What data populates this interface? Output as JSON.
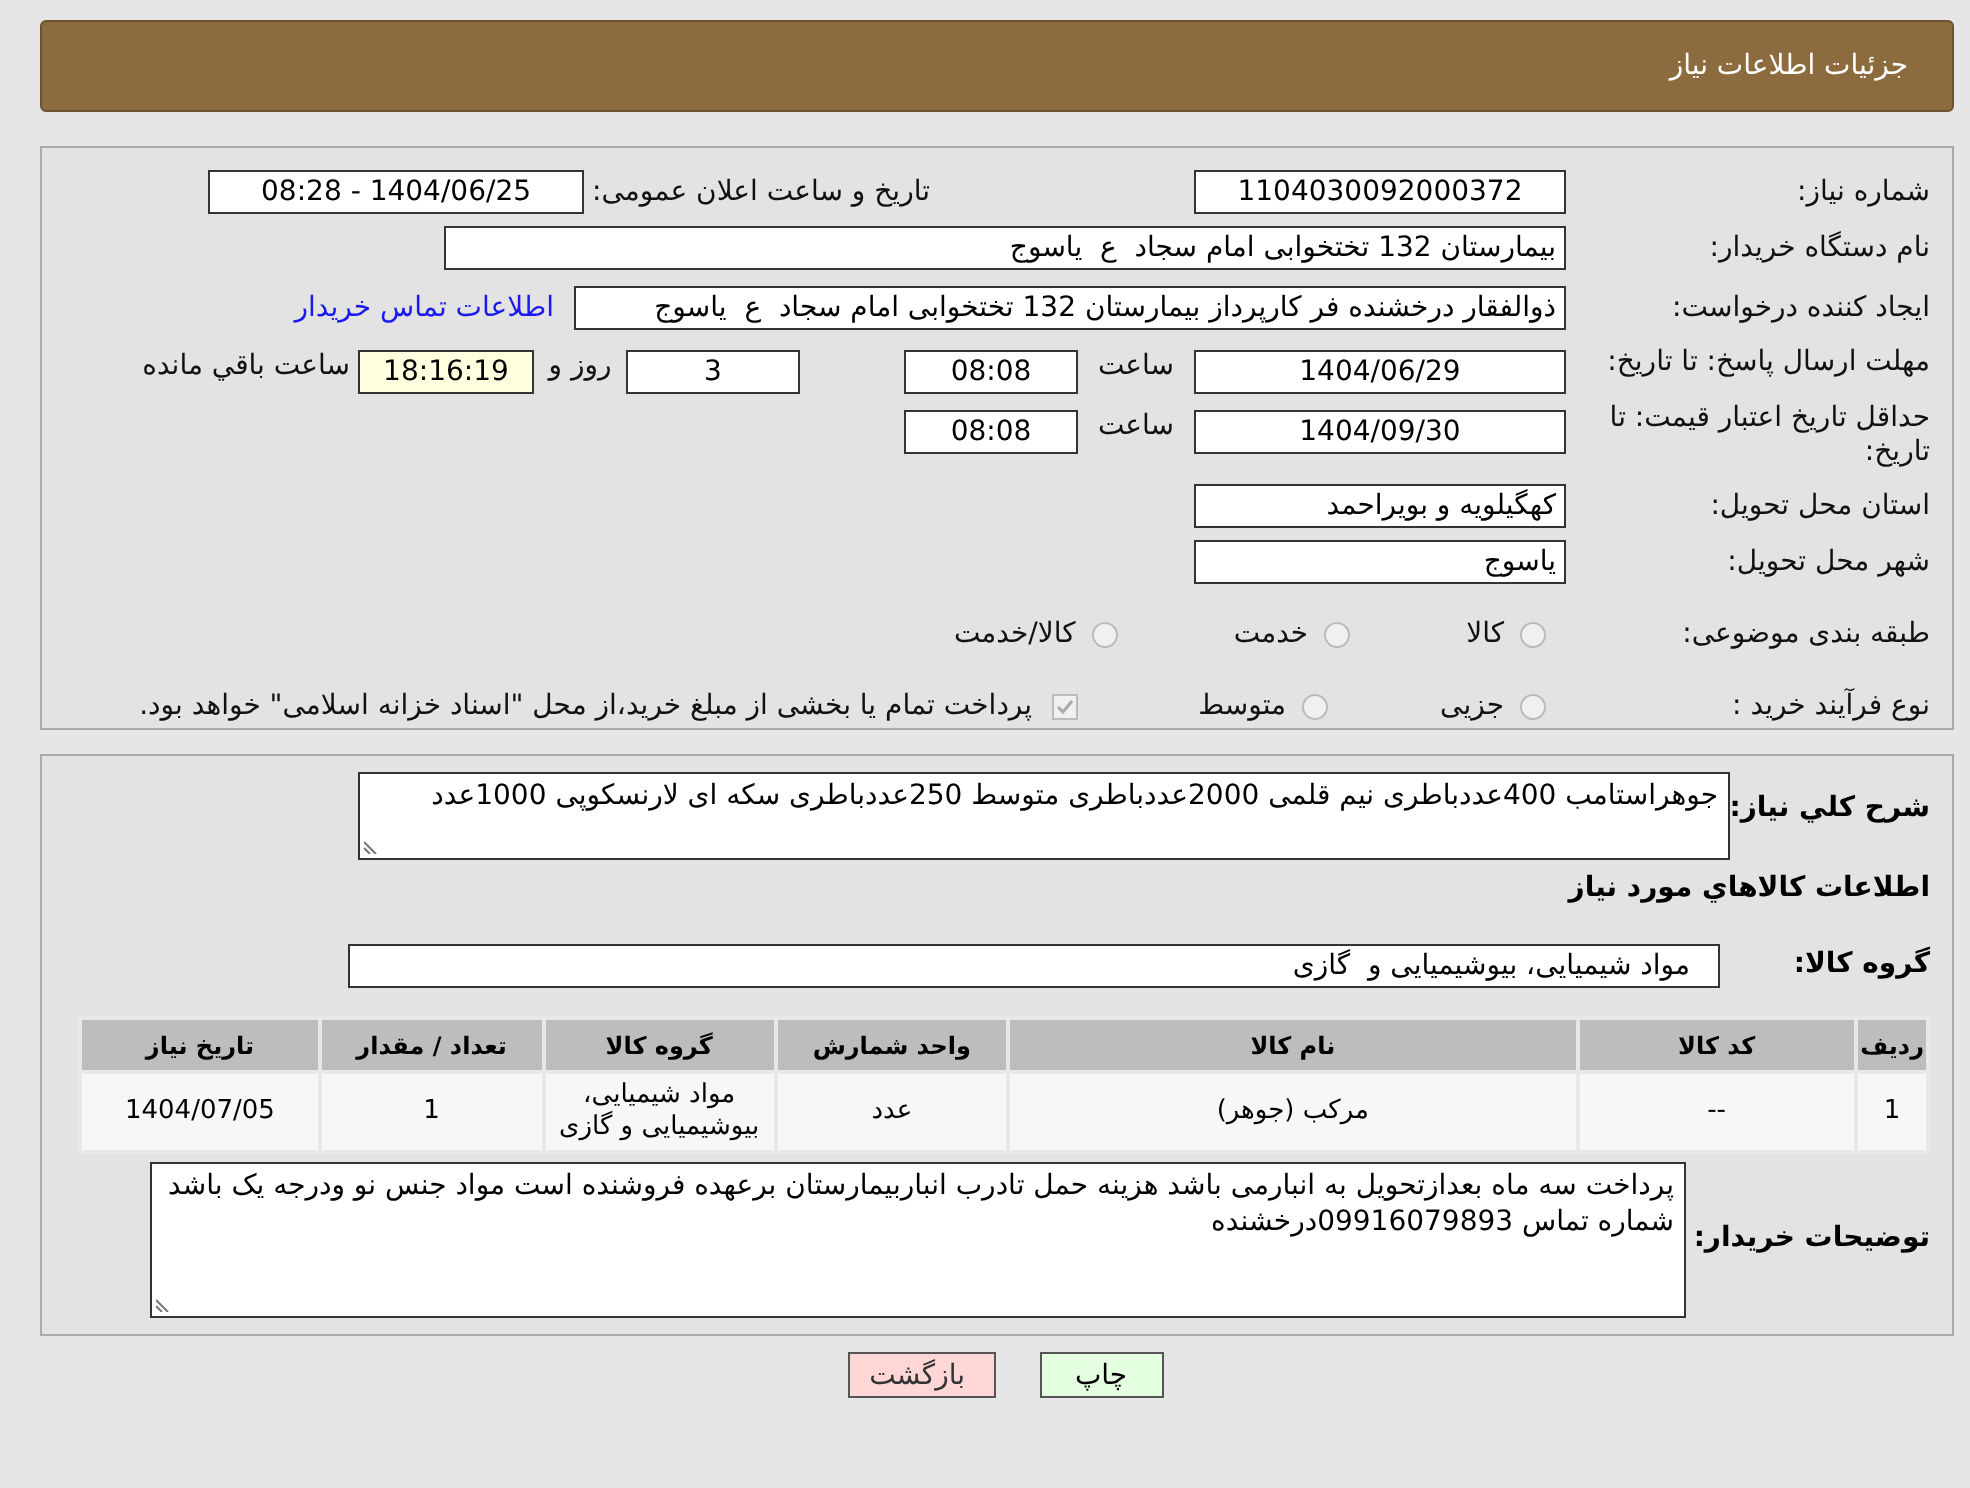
{
  "header": {
    "title": "جزئیات اطلاعات نیاز"
  },
  "info": {
    "need_number": {
      "label": "شماره نیاز:",
      "value": "1104030092000372"
    },
    "announce": {
      "label": "تاریخ و ساعت اعلان عمومی:",
      "value": "1404/06/25 - 08:28"
    },
    "buyer_org": {
      "label": "نام دستگاه خریدار:",
      "value": "بیمارستان 132 تختخوابی امام سجاد  ع  یاسوج"
    },
    "creator": {
      "label": "ایجاد کننده درخواست:",
      "value": "ذوالفقار درخشنده فر کارپرداز بیمارستان 132 تختخوابی امام سجاد  ع  یاسوج",
      "link": "اطلاعات تماس خریدار"
    },
    "deadline": {
      "label": "مهلت ارسال پاسخ: تا تاریخ:",
      "date": "1404/06/29",
      "time_label": "ساعت",
      "time": "08:08",
      "days": "3",
      "days_label": "روز و",
      "remaining": "18:16:19",
      "remaining_label": "ساعت باقي مانده"
    },
    "validity": {
      "label": "حداقل تاریخ اعتبار قیمت: تا تاریخ:",
      "date": "1404/09/30",
      "time_label": "ساعت",
      "time": "08:08"
    },
    "province": {
      "label": "استان محل تحویل:",
      "value": "کهگیلویه و بویراحمد"
    },
    "city": {
      "label": "شهر محل تحویل:",
      "value": "یاسوج"
    },
    "category": {
      "label": "طبقه بندی موضوعی:",
      "options": [
        {
          "label": "کالا",
          "selected": false,
          "disabled": true
        },
        {
          "label": "خدمت",
          "selected": false,
          "disabled": true
        },
        {
          "label": "کالا/خدمت",
          "selected": false,
          "disabled": true
        }
      ]
    },
    "process": {
      "label": "نوع فرآیند خرید :",
      "options": [
        {
          "label": "جزیی",
          "selected": false,
          "disabled": true
        },
        {
          "label": "متوسط",
          "selected": false,
          "disabled": true
        }
      ],
      "treasury": {
        "label": "پرداخت تمام یا بخشی از مبلغ خرید،از محل \"اسناد خزانه اسلامی\" خواهد بود.",
        "checked": true,
        "disabled": true
      }
    }
  },
  "needs": {
    "description": {
      "label": "شرح كلي نياز:",
      "value": "جوهراستامب 400عددباطری نیم قلمی 2000عددباطری متوسط 250عددباطری سکه ای لارنسکوپی 1000عدد"
    },
    "goods_title": "اطلاعات كالاهاي مورد نياز",
    "goods_group": {
      "label": "گروه کالا:",
      "value": "مواد شیمیایی، بیوشیمیایی و  گازی"
    },
    "table": {
      "columns": [
        "ردیف",
        "کد کالا",
        "نام کالا",
        "واحد شمارش",
        "گروه کالا",
        "تعداد / مقدار",
        "تاریخ نیاز"
      ],
      "rows": [
        [
          "1",
          "--",
          "مرکب (جوهر)",
          "عدد",
          "مواد شیمیایی، بیوشیمیایی و گازی",
          "1",
          "1404/07/05"
        ]
      ]
    },
    "buyer_notes": {
      "label": "توضیحات خریدار:",
      "value": "پرداخت سه ماه بعدازتحویل به انبارمی باشد هزینه حمل تادرب انباربیمارستان برعهده فروشنده است مواد جنس نو ودرجه یک باشد شماره تماس 09916079893درخشنده"
    }
  },
  "buttons": [
    {
      "kind": "print",
      "label": "چاپ"
    },
    {
      "kind": "back",
      "label": "بازگشت"
    }
  ]
}
